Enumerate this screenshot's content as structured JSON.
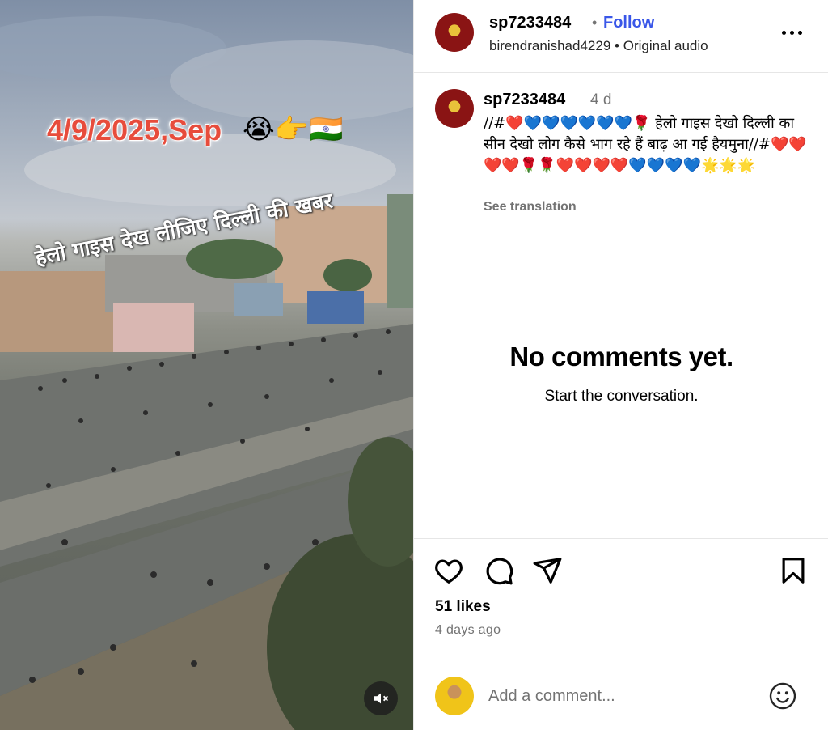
{
  "post": {
    "overlay_date": "4/9/2025,Sep",
    "overlay_emoji": "😭👉🇮🇳",
    "overlay_hindi": "हेलो गाइस देख लीजिए दिल्ली की खबर"
  },
  "header": {
    "username": "sp7233484",
    "separator": "•",
    "follow_label": "Follow",
    "audio_user": "birendranishad4229",
    "audio_sep": "•",
    "audio_label": "Original audio"
  },
  "caption": {
    "username": "sp7233484",
    "time": "4 d",
    "text": "//#❤️💙💙💙💙💙💙🌹 हेलो गाइस देखो दिल्ली का सीन देखो लोग कैसे भाग रहे हैं बाढ़ आ गई हैयमुना//#❤️❤️❤️❤️🌹🌹❤️❤️❤️❤️💙💙💙💙🌟🌟🌟",
    "see_translation": "See translation"
  },
  "comments": {
    "empty_title": "No comments yet.",
    "empty_subtitle": "Start the conversation."
  },
  "actions": {
    "likes": "51 likes",
    "posted": "4 days ago"
  },
  "composer": {
    "placeholder": "Add a comment..."
  },
  "icons": [
    "more-icon",
    "heart-icon",
    "comment-icon",
    "share-icon",
    "bookmark-icon",
    "emoji-icon",
    "mute-icon"
  ]
}
